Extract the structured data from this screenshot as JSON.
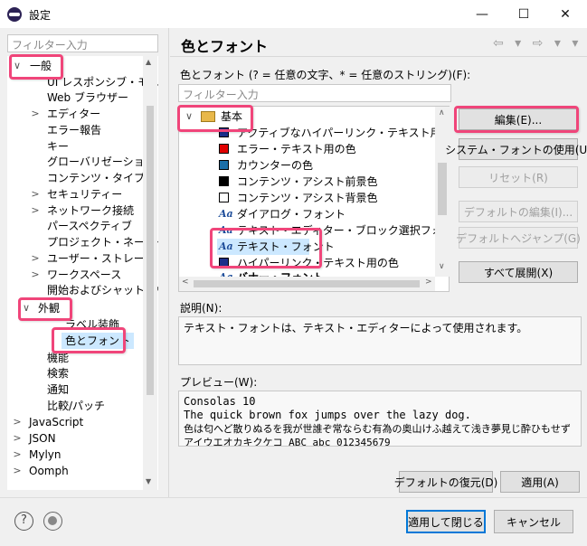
{
  "window": {
    "title": "設定",
    "controls": {
      "minimize": "—",
      "maximize": "☐",
      "close": "✕"
    }
  },
  "left": {
    "filter_placeholder": "フィルター入力",
    "tree": [
      {
        "label": "一般",
        "twisty": "∨"
      },
      {
        "label": "UI レスポンシブ・モニター",
        "twisty": ""
      },
      {
        "label": "Web ブラウザー",
        "twisty": ""
      },
      {
        "label": "エディター",
        "twisty": ">"
      },
      {
        "label": "エラー報告",
        "twisty": ""
      },
      {
        "label": "キー",
        "twisty": ""
      },
      {
        "label": "グローバリゼーション",
        "twisty": ""
      },
      {
        "label": "コンテンツ・タイプ",
        "twisty": ""
      },
      {
        "label": "セキュリティー",
        "twisty": ">"
      },
      {
        "label": "ネットワーク接続",
        "twisty": ">"
      },
      {
        "label": "パースペクティブ",
        "twisty": ""
      },
      {
        "label": "プロジェクト・ネーチャー",
        "twisty": ""
      },
      {
        "label": "ユーザー・ストレージ・サービス",
        "twisty": ">"
      },
      {
        "label": "ワークスペース",
        "twisty": ">"
      },
      {
        "label": "開始およびシャットダウン",
        "twisty": ""
      },
      {
        "label": "外観",
        "twisty": "∨"
      },
      {
        "label": "ラベル装飾",
        "twisty": ""
      },
      {
        "label": "色とフォント",
        "twisty": ""
      },
      {
        "label": "機能",
        "twisty": ""
      },
      {
        "label": "検索",
        "twisty": ""
      },
      {
        "label": "通知",
        "twisty": ""
      },
      {
        "label": "比較/パッチ",
        "twisty": ""
      },
      {
        "label": "JavaScript",
        "twisty": ">"
      },
      {
        "label": "JSON",
        "twisty": ">"
      },
      {
        "label": "Mylyn",
        "twisty": ">"
      },
      {
        "label": "Oomph",
        "twisty": ">"
      }
    ]
  },
  "main": {
    "title": "色とフォント",
    "nav_icons": "⇦ ▾ ⇨ ▾ ▾",
    "colors_label": "色とフォント (? = 任意の文字、* = 任意のストリング)(F):",
    "filter_placeholder": "フィルター入力",
    "tree": [
      {
        "label": "基本",
        "kind": "folder"
      },
      {
        "label": "アクティブなハイパーリンク・テキスト用の色",
        "kind": "color",
        "color": "#1a2f8a"
      },
      {
        "label": "エラー・テキスト用の色",
        "kind": "color",
        "color": "#e00000"
      },
      {
        "label": "カウンターの色",
        "kind": "color",
        "color": "#1b6fa8"
      },
      {
        "label": "コンテンツ・アシスト前景色",
        "kind": "color",
        "color": "#000000"
      },
      {
        "label": "コンテンツ・アシスト背景色",
        "kind": "color",
        "color": "#ffffff"
      },
      {
        "label": "ダイアログ・フォント",
        "kind": "font"
      },
      {
        "label": "テキスト・エディター・ブロック選択フォント",
        "kind": "font"
      },
      {
        "label": "テキスト・フォント",
        "kind": "font"
      },
      {
        "label": "ハイパーリンク・テキスト用の色",
        "kind": "color",
        "color": "#1a2f8a"
      },
      {
        "label": "バナー・フォント",
        "kind": "font"
      }
    ],
    "buttons": {
      "edit": "編集(E)...",
      "use_system_font": "システム・フォントの使用(U)",
      "reset": "リセット(R)",
      "edit_default": "デフォルトの編集(I)...",
      "goto_default": "デフォルトへジャンプ(G)",
      "expand_all": "すべて展開(X)"
    },
    "description_label": "説明(N):",
    "description_text": "テキスト・フォントは、テキスト・エディターによって使用されます。",
    "preview_label": "プレビュー(W):",
    "preview_lines": [
      "Consolas 10",
      "The quick brown fox jumps over the lazy dog.",
      "色は匂へど散りぬるを我が世誰ぞ常ならむ有為の奥山けふ越えて浅き夢見じ酔ひもせず",
      "アイウエオカキクケコ ABC abc 012345679"
    ],
    "restore_defaults": "デフォルトの復元(D)",
    "apply": "適用(A)"
  },
  "footer": {
    "help_icon": "?",
    "apply_close": "適用して閉じる",
    "cancel": "キャンセル"
  }
}
